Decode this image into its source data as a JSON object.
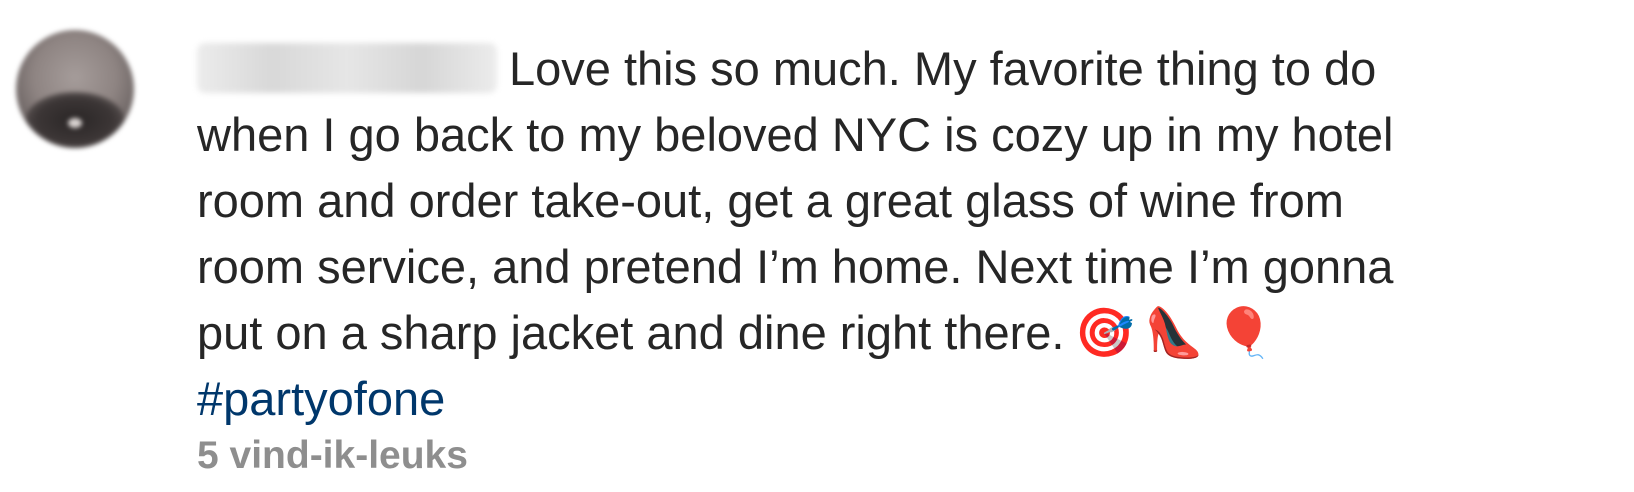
{
  "comment": {
    "lines": [
      "Love this so much. My favorite thing to do",
      "when I go back to my beloved NYC is cozy up in my hotel",
      "room and order take-out, get a great glass of wine from",
      "room service, and pretend I’m home. Next time I’m gonna",
      "put on a sharp jacket and dine right there."
    ],
    "emojis": [
      "🎯",
      "👠",
      "🎈"
    ],
    "hashtag": "#partyofone",
    "likes_label": "5 vind-ik-leuks"
  }
}
